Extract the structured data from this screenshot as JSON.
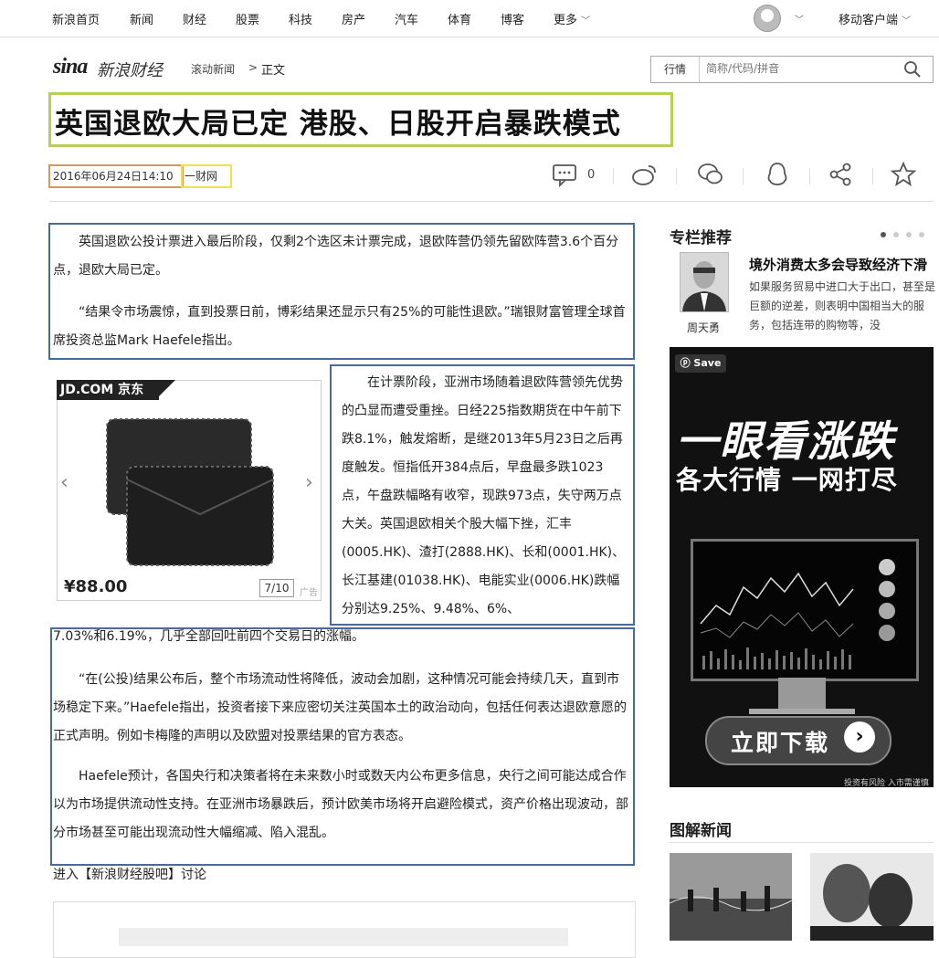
{
  "topnav": {
    "items": [
      "新浪首页",
      "新闻",
      "财经",
      "股票",
      "科技",
      "房产",
      "汽车",
      "体育",
      "博客",
      "更多"
    ],
    "mobile_label": "移动客户端"
  },
  "header": {
    "logo": "sina",
    "logo_sub": "新浪财经",
    "breadcrumb_category": "滚动新闻",
    "breadcrumb_arrow": ">",
    "breadcrumb_current": "正文",
    "search_type": "行情",
    "search_placeholder": "简称/代码/拼音"
  },
  "article": {
    "title": "英国退欧大局已定 港股、日股开启暴跌模式",
    "date": "2016年06月24日14:10",
    "source": "一财网",
    "comment_count": "0",
    "paragraphs": [
      "英国退欧公投计票进入最后阶段，仅剩2个选区未计票完成，退欧阵营仍领先留欧阵营3.6个百分点，退欧大局已定。",
      "“结果令市场震惊，直到投票日前，博彩结果还显示只有25%的可能性退欧。”瑞银财富管理全球首席投资总监Mark Haefele指出。",
      "在计票阶段，亚洲市场随着退欧阵营领先优势的凸显而遭受重挫。日经225指数期货在中午前下跌8.1%，触发熔断，是继2013年5月23日之后再度触发。恒指低开384点后，早盘最多跌1023点，午盘跌幅略有收窄，现跌973点，失守两万点大关。英国退欧相关个股大幅下挫，汇丰(0005.HK)、渣打(2888.HK)、长和(0001.HK)、长江基建(01038.HK)、电能实业(0006.HK)跌幅分别达9.25%、9.48%、6%、",
      "7.03%和6.19%，几乎全部回吐前四个交易日的涨幅。",
      "“在(公投)结果公布后，整个市场流动性将降低，波动会加剧，这种情况可能会持续几天，直到市场稳定下来。”Haefele指出，投资者接下来应密切关注英国本土的政治动向，包括任何表达退欧意愿的正式声明。例如卡梅隆的声明以及欧盟对投票结果的官方表态。",
      "Haefele预计，各国央行和决策者将在未来数小时或数天内公布更多信息，央行之间可能达成合作以为市场提供流动性支持。在亚洲市场暴跌后，预计欧美市场将开启避险模式，资产价格出现波动，部分市场甚至可能出现流动性大幅缩减、陷入混乱。"
    ],
    "discuss": "进入【新浪财经股吧】讨论"
  },
  "ad": {
    "brand": "JD.COM 京东",
    "price": "¥88.00",
    "page": "7/10",
    "tag": "广告"
  },
  "sidebar": {
    "column_title": "专栏推荐",
    "column_author": "周天勇",
    "column_headline": "境外消费太多会导致经济下滑",
    "column_desc": "如果服务贸易中进口大于出口，甚至是巨额的逆差，则表明中国相当大的服务，包括连带的购物等，没",
    "banner_save": "Save",
    "banner_line1": "一眼看涨跌",
    "banner_line2": "各大行情 一网打尽",
    "banner_button": "立即下载",
    "banner_note": "投资有风险 入市需谨慎",
    "pic_title": "图解新闻"
  }
}
